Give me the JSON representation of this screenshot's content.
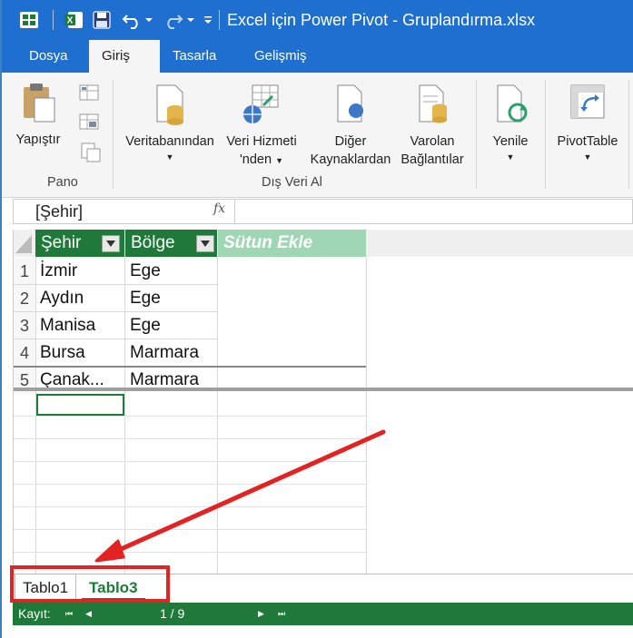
{
  "window": {
    "title": "Excel için Power Pivot - Gruplandırma.xlsx"
  },
  "menu_tabs": [
    "Dosya",
    "Giriş",
    "Tasarla",
    "Gelişmiş"
  ],
  "ribbon": {
    "pano": {
      "paste_label": "Yapıştır",
      "group_label": "Pano"
    },
    "dis_veri_al": {
      "group_label": "Dış Veri Al",
      "from_database": "Veritabanından",
      "from_service_line1": "Veri Hizmeti",
      "from_service_line2": "'nden",
      "from_other_line1": "Diğer",
      "from_other_line2": "Kaynaklardan",
      "existing_line1": "Varolan",
      "existing_line2": "Bağlantılar"
    },
    "refresh": "Yenile",
    "pivottable": "PivotTable"
  },
  "formula_bar": {
    "name_box": "[Şehir]",
    "fx": "fx"
  },
  "table": {
    "columns": [
      "Şehir",
      "Bölge"
    ],
    "add_column": "Sütun Ekle",
    "rows": [
      {
        "num": "1",
        "sehir": "İzmir",
        "bolge": "Ege"
      },
      {
        "num": "2",
        "sehir": "Aydın",
        "bolge": "Ege"
      },
      {
        "num": "3",
        "sehir": "Manisa",
        "bolge": "Ege"
      },
      {
        "num": "4",
        "sehir": "Bursa",
        "bolge": "Marmara"
      },
      {
        "num": "5",
        "sehir": "Çanak...",
        "bolge": "Marmara"
      }
    ]
  },
  "sheet_tabs": [
    "Tablo1",
    "Tablo3"
  ],
  "status": {
    "record_label": "Kayıt:",
    "record_value": "1 / 9"
  },
  "colors": {
    "titlebar": "#1e6fd0",
    "header_green": "#1f7a3a",
    "add_column_green": "#9fd6b4",
    "annotation_red": "#e32222"
  }
}
